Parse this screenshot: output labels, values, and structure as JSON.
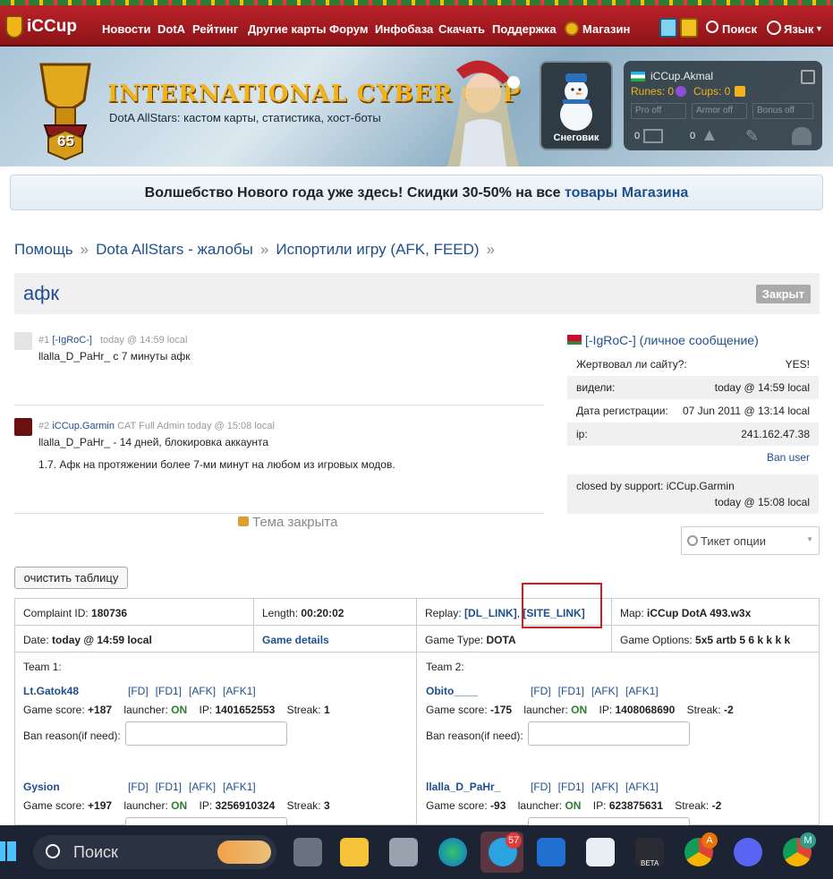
{
  "header": {
    "logo_text": "iCCup",
    "nav": [
      "Новости",
      "DotA",
      "Рейтинг",
      "Другие карты",
      "Форум",
      "Инфобаза",
      "Скачать",
      "Поддержка",
      "Магазин"
    ],
    "search_label": "Поиск",
    "language_label": "Язык"
  },
  "banner": {
    "title": "INTERNATIONAL CYBER CUP",
    "subtitle": "DotA AllStars: кастом карты, статистика, хост-боты",
    "level": "65",
    "snowman_label": "Снеговик",
    "user": {
      "name": "iCCup.Akmal",
      "runes_label": "Runes: 0",
      "cups_label": "Cups: 0",
      "options": [
        "Pro off",
        "Armor off",
        "Bonus off"
      ],
      "messages_count": "0",
      "alerts_count": "0"
    }
  },
  "promo": {
    "text": "Волшебство Нового года уже здесь! Скидки 30-50% на все",
    "link": "товары Магазина"
  },
  "breadcrumb": [
    "Помощь",
    "Dota AllStars - жалобы",
    "Испортили игру (AFK, FEED)"
  ],
  "breadcrumb_sep": "»",
  "thread": {
    "title": "афк",
    "status": "Закрыт",
    "closed_text": "Тема закрыта"
  },
  "posts": [
    {
      "num": "#1",
      "author": "[-IgRoC-]",
      "role": "",
      "time": "today @ 14:59 local",
      "lines": [
        "llalla_D_PaHr_ с 7 минуты афк"
      ]
    },
    {
      "num": "#2",
      "author": "iCCup.Garmin",
      "role": "CAT Full Admin",
      "time": "today @ 15:08 local",
      "lines": [
        "llalla_D_PaHr_ - 14 дней, блокировка аккаунта",
        "1.7. Афк на протяжении более 7-ми минут на любом из игровых модов."
      ]
    }
  ],
  "profile": {
    "name": "[-IgRoC-]",
    "pm_link": "личное сообщение",
    "rows": [
      {
        "label": "Жертвовал ли сайту?:",
        "value": "YES!"
      },
      {
        "label": "видели:",
        "value": "today @ 14:59 local"
      },
      {
        "label": "Дата регистрации:",
        "value": "07 Jun 2011 @ 13:14 local"
      },
      {
        "label": "ip:",
        "value": "241.162.47.38"
      }
    ],
    "ban_user": "Ban user",
    "closed_by": "closed by support: iCCup.Garmin",
    "closed_time": "today @ 15:08 local",
    "ticket_options": "Тикет опции"
  },
  "clear_button": "очистить таблицу",
  "complaint": {
    "id_label": "Complaint ID:",
    "id": "180736",
    "length_label": "Length:",
    "length": "00:20:02",
    "replay_label": "Replay:",
    "dl_link": "[DL_LINK]",
    "site_link": "[SITE_LINK]",
    "map_label": "Map:",
    "map": "iCCup DotA 493.w3x",
    "date_label": "Date:",
    "date": "today @ 14:59 local",
    "game_details": "Game details",
    "game_type_label": "Game Type:",
    "game_type": "DOTA",
    "game_options_label": "Game Options:",
    "game_options": "5x5 artb 5 6 k k k k"
  },
  "teams": [
    {
      "label": "Team 1:",
      "players": [
        {
          "name": "Lt.Gatok48",
          "score": "+187",
          "launcher": "ON",
          "ip": "1401652553",
          "streak": "1"
        },
        {
          "name": "Gysion",
          "score": "+197",
          "launcher": "ON",
          "ip": "3256910324",
          "streak": "3"
        }
      ]
    },
    {
      "label": "Team 2:",
      "players": [
        {
          "name": "Obito____",
          "score": "-175",
          "launcher": "ON",
          "ip": "1408068690",
          "streak": "-2"
        },
        {
          "name": "llalla_D_PaHr_",
          "score": "-93",
          "launcher": "ON",
          "ip": "623875631",
          "streak": "-2"
        }
      ]
    }
  ],
  "player_links": [
    "[FD]",
    "[FD1]",
    "[AFK]",
    "[AFK1]"
  ],
  "labels": {
    "game_score": "Game score:",
    "launcher": "launcher:",
    "ip": "IP:",
    "streak": "Streak:",
    "ban_reason": "Ban reason(if need):"
  },
  "taskbar": {
    "search": "Поиск",
    "telegram_badge": "57",
    "chrome_badge": "A",
    "chrome2_badge": "M",
    "beta_label": "BETA"
  }
}
